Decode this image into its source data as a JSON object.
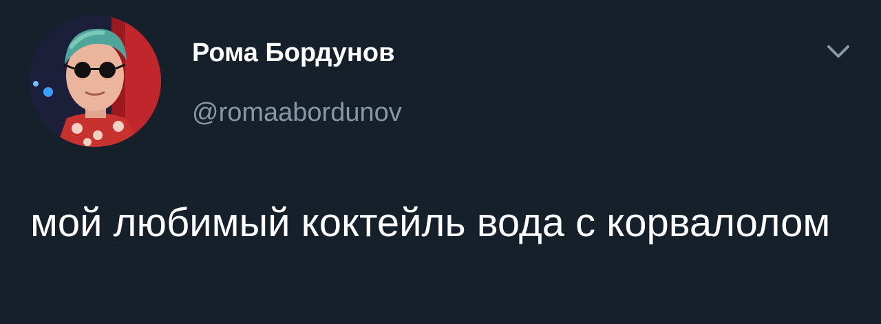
{
  "tweet": {
    "author": {
      "display_name": "Рома Бордунов",
      "handle": "@romaabordunov",
      "avatar": "user-avatar-photo"
    },
    "text": "мой любимый коктейль вода с корвалолом",
    "menu_icon": "chevron-down-icon"
  },
  "colors": {
    "background": "#15202b",
    "name": "#ffffff",
    "handle": "#8899a6",
    "text": "#ffffff",
    "icon": "#8899a6"
  }
}
